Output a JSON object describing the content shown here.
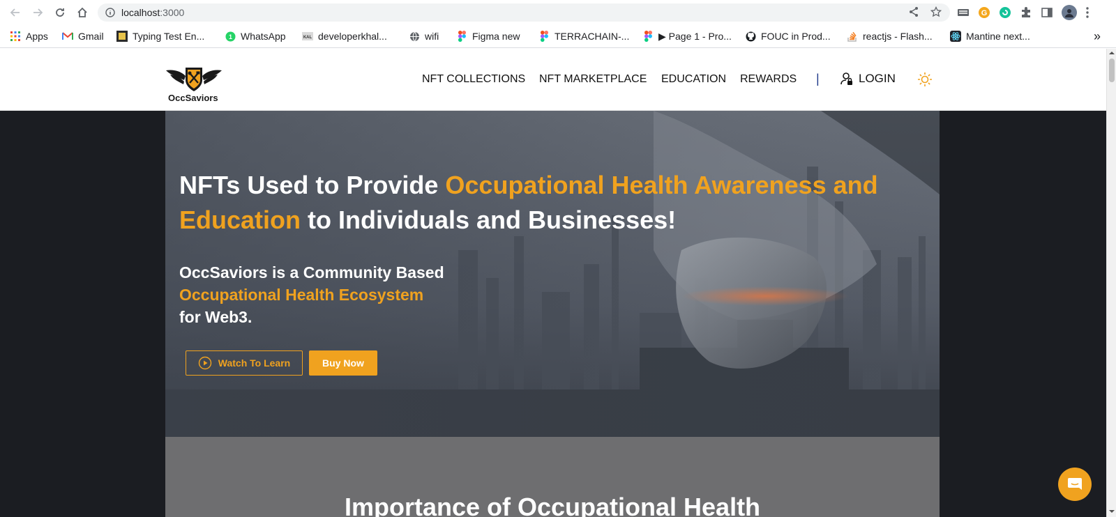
{
  "browser": {
    "url_host": "localhost",
    "url_port": ":3000"
  },
  "bookmarks": [
    {
      "label": "Apps",
      "icon": "apps-grid-icon"
    },
    {
      "label": "Gmail",
      "icon": "gmail-icon"
    },
    {
      "label": "Typing Test En...",
      "icon": "typing-test-icon"
    },
    {
      "label": "WhatsApp",
      "icon": "whatsapp-icon"
    },
    {
      "label": "developerkhal...",
      "icon": "developer-icon"
    },
    {
      "label": "wifi",
      "icon": "globe-icon"
    },
    {
      "label": "Figma new",
      "icon": "figma-icon"
    },
    {
      "label": "TERRACHAIN-...",
      "icon": "figma-icon"
    },
    {
      "label": "▶ Page 1 - Pro...",
      "icon": "figma-icon"
    },
    {
      "label": "FOUC in Prod...",
      "icon": "github-icon"
    },
    {
      "label": "reactjs - Flash...",
      "icon": "stackoverflow-icon"
    },
    {
      "label": "Mantine next...",
      "icon": "react-icon"
    }
  ],
  "bookmarks_overflow": "»",
  "site": {
    "logo_text": "OccSaviors",
    "nav": [
      "NFT COLLECTIONS",
      "NFT MARKETPLACE",
      "EDUCATION",
      "REWARDS"
    ],
    "divider": "|",
    "login": "LOGIN"
  },
  "hero": {
    "title_part1": "NFTs Used to Provide ",
    "title_highlight": "Occupational Health Awareness and Education",
    "title_part2": " to Individuals and Businesses!",
    "sub_line1": "OccSaviors is a Community Based",
    "sub_highlight": "Occupational Health Ecosystem",
    "sub_line3": "for Web3.",
    "btn_watch": "Watch To Learn",
    "btn_buy": "Buy Now"
  },
  "section2": {
    "title": "Importance of Occupational Health"
  },
  "colors": {
    "accent": "#f0a21f",
    "page_bg": "#1b1d22",
    "hero_bg": "#4d5460",
    "section_bg": "#6e6e70"
  }
}
